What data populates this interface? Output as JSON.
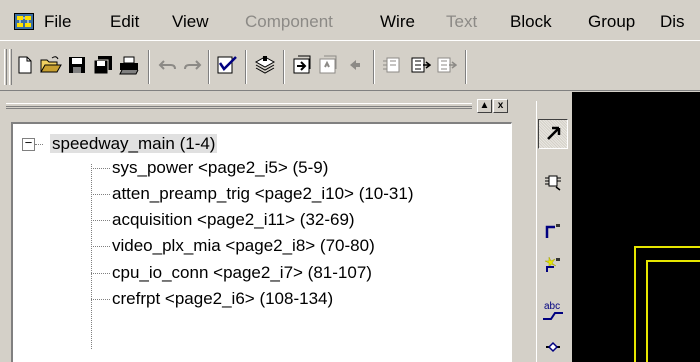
{
  "menu": {
    "items": [
      "File",
      "Edit",
      "View",
      "Component",
      "Wire",
      "Text",
      "Block",
      "Group",
      "Dis"
    ],
    "disabled": [
      "Component",
      "Text"
    ]
  },
  "toolbar": {
    "buttons": [
      "new-file-icon",
      "open-folder-icon",
      "save-icon",
      "save-all-icon",
      "print-icon",
      "undo-icon",
      "redo-icon",
      "check-icon",
      "stack-icon",
      "push-icon",
      "pop-icon",
      "back-arrow-icon",
      "component-a-icon",
      "component-b-icon",
      "component-c-icon"
    ]
  },
  "hierarchy_pane": {
    "minimize_glyph": "▲",
    "close_glyph": "x",
    "root": {
      "expander": "−",
      "label": "speedway_main (1-4)"
    },
    "children": [
      {
        "label": "sys_power <page2_i5> (5-9)"
      },
      {
        "label": "atten_preamp_trig <page2_i10> (10-31)"
      },
      {
        "label": "acquisition <page2_i11> (32-69)"
      },
      {
        "label": "video_plx_mia <page2_i8> (70-80)"
      },
      {
        "label": "cpu_io_conn <page2_i7> (81-107)"
      },
      {
        "label": "crefrpt <page2_i6> (108-134)"
      }
    ]
  },
  "palette": {
    "tools": [
      "select-arrow-icon",
      "add-component-icon",
      "add-wire-icon",
      "add-net-icon",
      "add-label-icon",
      "add-connector-icon"
    ],
    "abc_text": "abc"
  },
  "colors": {
    "chrome": "#d4d0c8",
    "canvas": "#000000",
    "schematic_frame": "#e6e600",
    "disabled_text": "#8c8a86"
  }
}
